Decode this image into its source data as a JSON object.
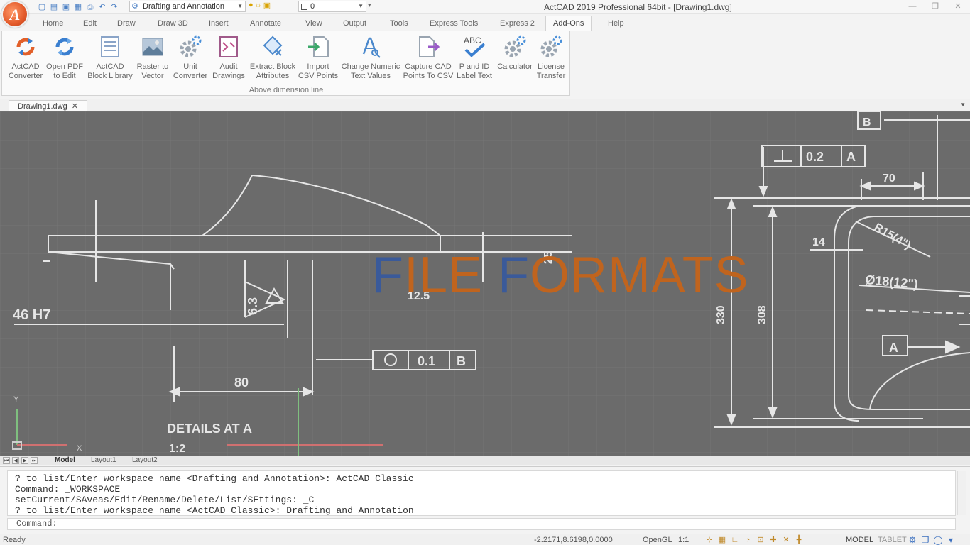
{
  "window": {
    "title": "ActCAD 2019 Professional 64bit - [Drawing1.dwg]",
    "logo_letter": "A"
  },
  "quick_access": {
    "workspace": "Drafting and Annotation",
    "layer": "0"
  },
  "ribbon": {
    "tabs": [
      "Home",
      "Edit",
      "Draw",
      "Draw 3D",
      "Insert",
      "Annotate",
      "View",
      "Output",
      "Tools",
      "Express Tools",
      "Express 2",
      "Add-Ons",
      "Help"
    ],
    "active_tab": "Add-Ons",
    "buttons": [
      {
        "line1": "ActCAD",
        "line2": "Converter",
        "icon": "sync-icon"
      },
      {
        "line1": "Open PDF",
        "line2": "to Edit",
        "icon": "pdf-sync-icon"
      },
      {
        "line1": "ActCAD",
        "line2": "Block Library",
        "icon": "library-icon"
      },
      {
        "line1": "Raster to",
        "line2": "Vector",
        "icon": "raster-icon"
      },
      {
        "line1": "Unit",
        "line2": "Converter",
        "icon": "gear-icon"
      },
      {
        "line1": "Audit",
        "line2": "Drawings",
        "icon": "audit-icon"
      },
      {
        "line1": "Extract Block",
        "line2": "Attributes",
        "icon": "extract-icon"
      },
      {
        "line1": "Import",
        "line2": "CSV Points",
        "icon": "import-icon"
      },
      {
        "line1": "Change Numeric",
        "line2": "Text Values",
        "icon": "text-search-icon"
      },
      {
        "line1": "Capture CAD",
        "line2": "Points To CSV",
        "icon": "export-icon"
      },
      {
        "line1": "P and ID",
        "line2": "Label Text",
        "icon": "abc-check-icon"
      },
      {
        "line1": "Calculator",
        "line2": "",
        "icon": "gear-icon"
      },
      {
        "line1": "License",
        "line2": "Transfer",
        "icon": "gear-icon"
      }
    ],
    "panel_caption": "Above dimension line"
  },
  "documents": {
    "tabs": [
      {
        "label": "Drawing1.dwg"
      }
    ]
  },
  "drawing": {
    "overlay_title_blue1": "F",
    "overlay_title_orange1": "ILE ",
    "overlay_title_blue2": "F",
    "overlay_title_orange2": "ORMATS",
    "labels": {
      "fit": "46 H7",
      "roughness": "6.3",
      "dim_80": "80",
      "dim_125": "12.5",
      "dim_25": "25",
      "details": "DETAILS AT A",
      "scale": "1:2",
      "tol_flat": "0.1",
      "tol_flat_ref": "B",
      "tol_perp": "0.2",
      "tol_perp_ref": "A",
      "ref_b": "B",
      "ref_a": "A",
      "dim_70": "70",
      "dim_14": "14",
      "radius": "R15(4\")",
      "diameter": "Ø18(12\")",
      "dim_330": "330",
      "dim_308": "308",
      "ucs_y": "Y",
      "ucs_x": "X"
    }
  },
  "layout_tabs": [
    "Model",
    "Layout1",
    "Layout2"
  ],
  "command": {
    "history": [
      "? to list/Enter workspace name <Drafting and Annotation>: ActCAD Classic",
      "Command: _WORKSPACE",
      "setCurrent/SAveas/Edit/Rename/Delete/List/SEttings: _C",
      "? to list/Enter workspace name <ActCAD Classic>: Drafting and Annotation"
    ],
    "prompt": "Command:"
  },
  "status": {
    "ready": "Ready",
    "coords": "-2.2171,8.6198,0.0000",
    "render": "OpenGL",
    "scale": "1:1",
    "model": "MODEL",
    "tablet": "TABLET"
  },
  "colors": {
    "canvas": "#6b6b6b",
    "title_blue": "#3a5a9a",
    "title_orange": "#c0641e"
  }
}
